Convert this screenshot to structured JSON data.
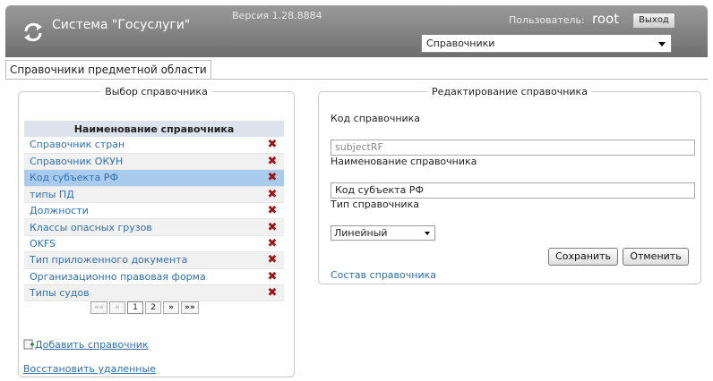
{
  "header": {
    "app_title": "Система \"Госуслуги\"",
    "version": "Версия 1.28.8884",
    "user_label": "Пользователь:",
    "user_name": "root",
    "logout_label": "Выход",
    "section_select_value": "Справочники",
    "bg_color": "#7d7d7d"
  },
  "tab": {
    "label": "Справочники предметной области"
  },
  "left_panel": {
    "legend": "Выбор справочника",
    "table_header": "Наименование справочника",
    "rows": [
      {
        "name": "Справочник стран"
      },
      {
        "name": "Справочник ОКУН"
      },
      {
        "name": "Код субъекта РФ"
      },
      {
        "name": "типы ПД"
      },
      {
        "name": "Должности"
      },
      {
        "name": "Классы опасных грузов"
      },
      {
        "name": "OKFS"
      },
      {
        "name": "Тип приложенного документа"
      },
      {
        "name": "Организационно правовая форма"
      },
      {
        "name": "Типы судов"
      }
    ],
    "selected_row": "Код субъекта РФ",
    "delete_icon": "delete-x-icon",
    "pager": {
      "first": "««",
      "prev": "«",
      "pages": [
        "1",
        "2"
      ],
      "current": "1",
      "next": "»",
      "last": "»»"
    },
    "add_link": "Добавить справочник",
    "restore_link": "Восстановить удаленные"
  },
  "right_panel": {
    "legend": "Редактирование справочника",
    "code_label": "Код справочника",
    "code_value": "subjectRF",
    "name_label": "Наименование справочника",
    "name_value": "Код субъекта РФ",
    "type_label": "Тип справочника",
    "type_value": "Линейный",
    "save_label": "Сохранить",
    "cancel_label": "Отменить",
    "composition_link": "Состав справочника"
  },
  "colors": {
    "link": "#2f6fb3",
    "selected_row": "#a9cbee",
    "delete": "#a01414"
  }
}
